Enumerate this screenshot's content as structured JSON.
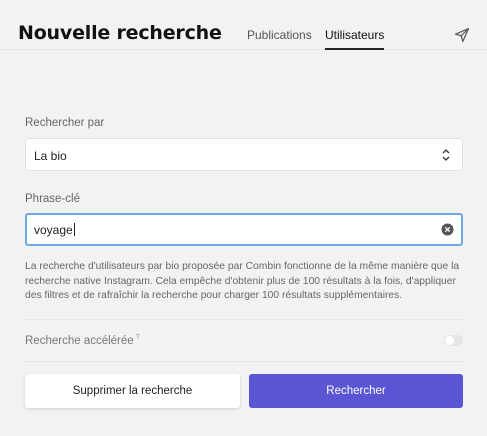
{
  "header": {
    "title": "Nouvelle recherche",
    "tabs": [
      {
        "label": "Publications",
        "active": false
      },
      {
        "label": "Utilisateurs",
        "active": true
      }
    ],
    "send_icon": "send-icon"
  },
  "form": {
    "search_by": {
      "label": "Rechercher par",
      "value": "La bio",
      "icon": "chevron-updown-icon"
    },
    "keyword": {
      "label": "Phrase-clé",
      "value": "voyage",
      "clear_icon": "clear-icon"
    },
    "help_text": "La recherche d'utilisateurs par bio proposée par Combin fonctionne de la même manière que la recherche native Instagram. Cela empêche d'obtenir plus de 100 résultats à la fois, d'appliquer des filtres et de rafraîchir la recherche pour charger 100 résultats supplémentaires.",
    "accelerated": {
      "label": "Recherche accélérée",
      "help_marker": "?",
      "enabled": false
    }
  },
  "actions": {
    "delete_label": "Supprimer la recherche",
    "search_label": "Rechercher"
  },
  "colors": {
    "primary": "#5a55d2",
    "focus_border": "#6fa8e6",
    "background": "#f2f2f2"
  }
}
